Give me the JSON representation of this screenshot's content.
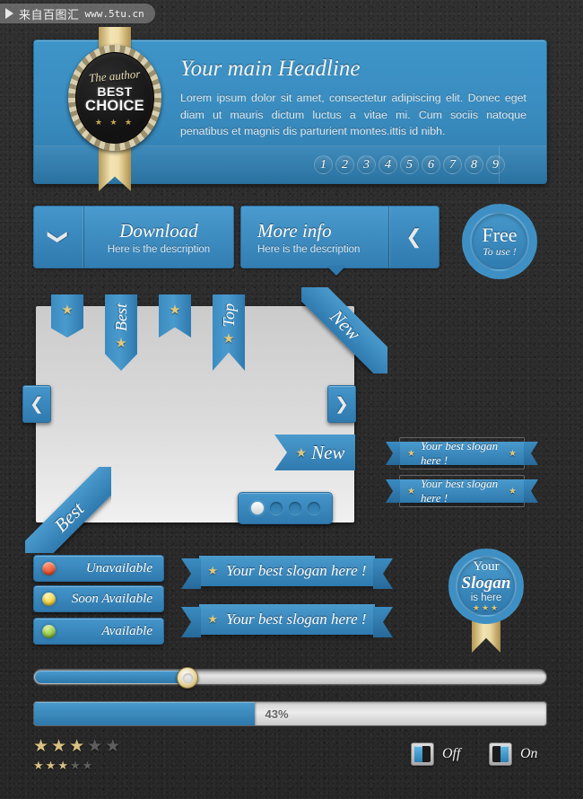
{
  "watermark": {
    "cn_text": "来自百图汇",
    "url": "www.5tu.cn",
    "triangle_icon": "play-triangle-icon"
  },
  "header": {
    "title": "Your main Headline",
    "paragraph": "Lorem ipsum dolor sit amet, consectetur adipiscing elit. Donec eget diam ut mauris dictum luctus a vitae mi. Cum sociis natoque penatibus et magnis dis parturient montes.ittis id nibh.",
    "pagination": [
      "1",
      "2",
      "3",
      "4",
      "5",
      "6",
      "7",
      "8",
      "9"
    ]
  },
  "author_badge": {
    "script_line": "The author",
    "line2": "BEST",
    "line3": "CHOICE",
    "stars": "★ ★ ★"
  },
  "buttons": {
    "download": {
      "title": "Download",
      "subtitle": "Here is the description",
      "icon": "chevron-down-icon",
      "glyph": "❯"
    },
    "more_info": {
      "title": "More info",
      "subtitle": "Here is the description",
      "icon": "chevron-left-icon",
      "glyph": "❮"
    }
  },
  "free_badge": {
    "line1": "Free",
    "line2": "To use !"
  },
  "bookmarks": [
    {
      "name": "star-only-pointed",
      "label": "",
      "star": "★"
    },
    {
      "name": "best-pointed",
      "label": "Best",
      "star": "★"
    },
    {
      "name": "star-only-notched",
      "label": "",
      "star": "★"
    },
    {
      "name": "top-notched",
      "label": "Top",
      "star": "★"
    }
  ],
  "corner_ribbons": {
    "new": "New",
    "best": "Best"
  },
  "nav": {
    "prev_glyph": "❮",
    "next_glyph": "❯"
  },
  "flag": {
    "star": "★",
    "label": "New"
  },
  "dots": {
    "count": 4,
    "active_index": 0
  },
  "small_banners": [
    {
      "star": "★",
      "text": "Your best slogan here !"
    },
    {
      "star": "★",
      "text": "Your best slogan here !"
    }
  ],
  "status_items": [
    {
      "label": "Unavailable",
      "color": "#e8542f"
    },
    {
      "label": "Soon Available",
      "color": "#f0d23a"
    },
    {
      "label": "Available",
      "color": "#8cc63e"
    }
  ],
  "large_banners": [
    {
      "star": "★",
      "text": "Your best slogan here !"
    },
    {
      "star": "★",
      "text": "Your best slogan here !"
    }
  ],
  "slogan_badge": {
    "line1": "Your",
    "line2": "Slogan",
    "line3": "is here",
    "stars": "★★★"
  },
  "slider": {
    "value_percent": 30
  },
  "progress": {
    "value_percent": 43,
    "label": "43%"
  },
  "ratings": {
    "big": {
      "filled": 3,
      "total": 5,
      "star_glyph": "★"
    },
    "small": {
      "filled": 3,
      "total": 5,
      "star_glyph": "★"
    }
  },
  "toggles": [
    {
      "label": "Off",
      "state": "off"
    },
    {
      "label": "On",
      "state": "on"
    }
  ],
  "colors": {
    "accent": "#3e8fc3",
    "gold": "#dfc87f",
    "panel": "#dcdcdc",
    "background": "#2b2b2b"
  }
}
